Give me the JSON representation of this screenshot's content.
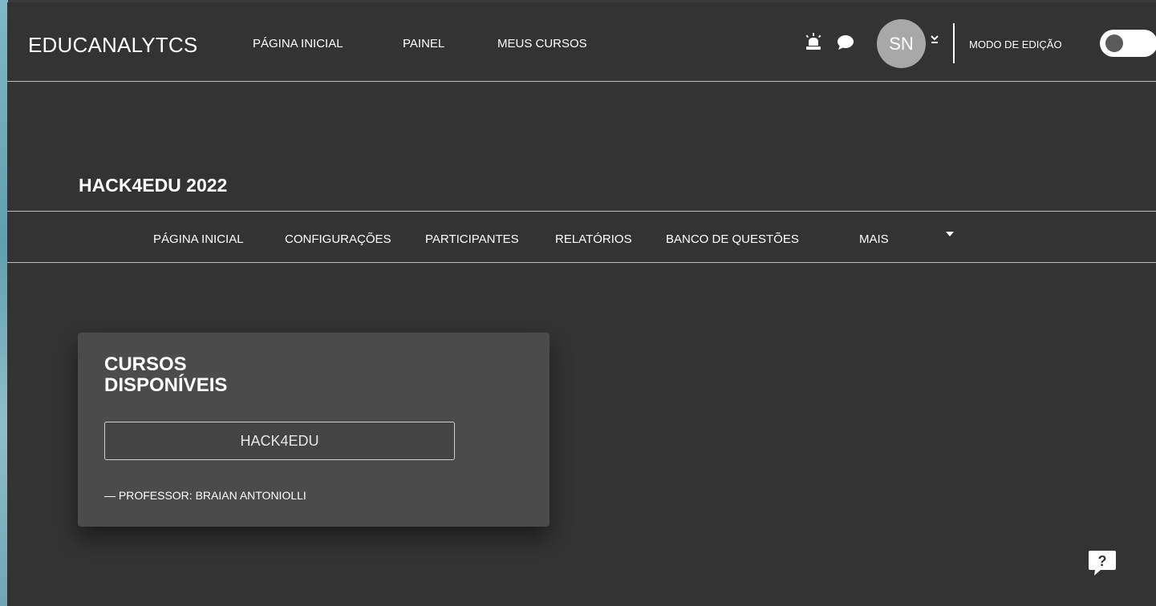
{
  "navbar": {
    "brand": "EDUCANALYTCS",
    "links": [
      "PÁGINA INICIAL",
      "PAINEL",
      "MEUS CURSOS"
    ],
    "notification_icon": "bell-alert-icon",
    "message_icon": "chat-bubble-icon",
    "avatar_initials": "SN",
    "user_menu_icon": "chevron-down-icon",
    "edit_mode_label": "MODO DE EDIÇÃO",
    "edit_mode_on": false
  },
  "course": {
    "title": "HACK4EDU 2022",
    "secondary_nav": [
      "PÁGINA INICIAL",
      "CONFIGURAÇÕES",
      "PARTICIPANTES",
      "RELATÓRIOS",
      "BANCO DE QUESTÕES",
      "MAIS"
    ]
  },
  "card": {
    "title_line1": "CURSOS",
    "title_line2": "DISPONÍVEIS",
    "course_button": "HACK4EDU",
    "teacher": "— PROFESSOR: BRAIAN ANTONIOLLI"
  },
  "help": {
    "icon": "help-question-icon",
    "glyph": "?"
  },
  "colors": {
    "page_bg": "#333333",
    "card_bg": "#4b4b4b",
    "avatar_bg": "#a8a8a8",
    "divider": "#bdbdbd"
  }
}
